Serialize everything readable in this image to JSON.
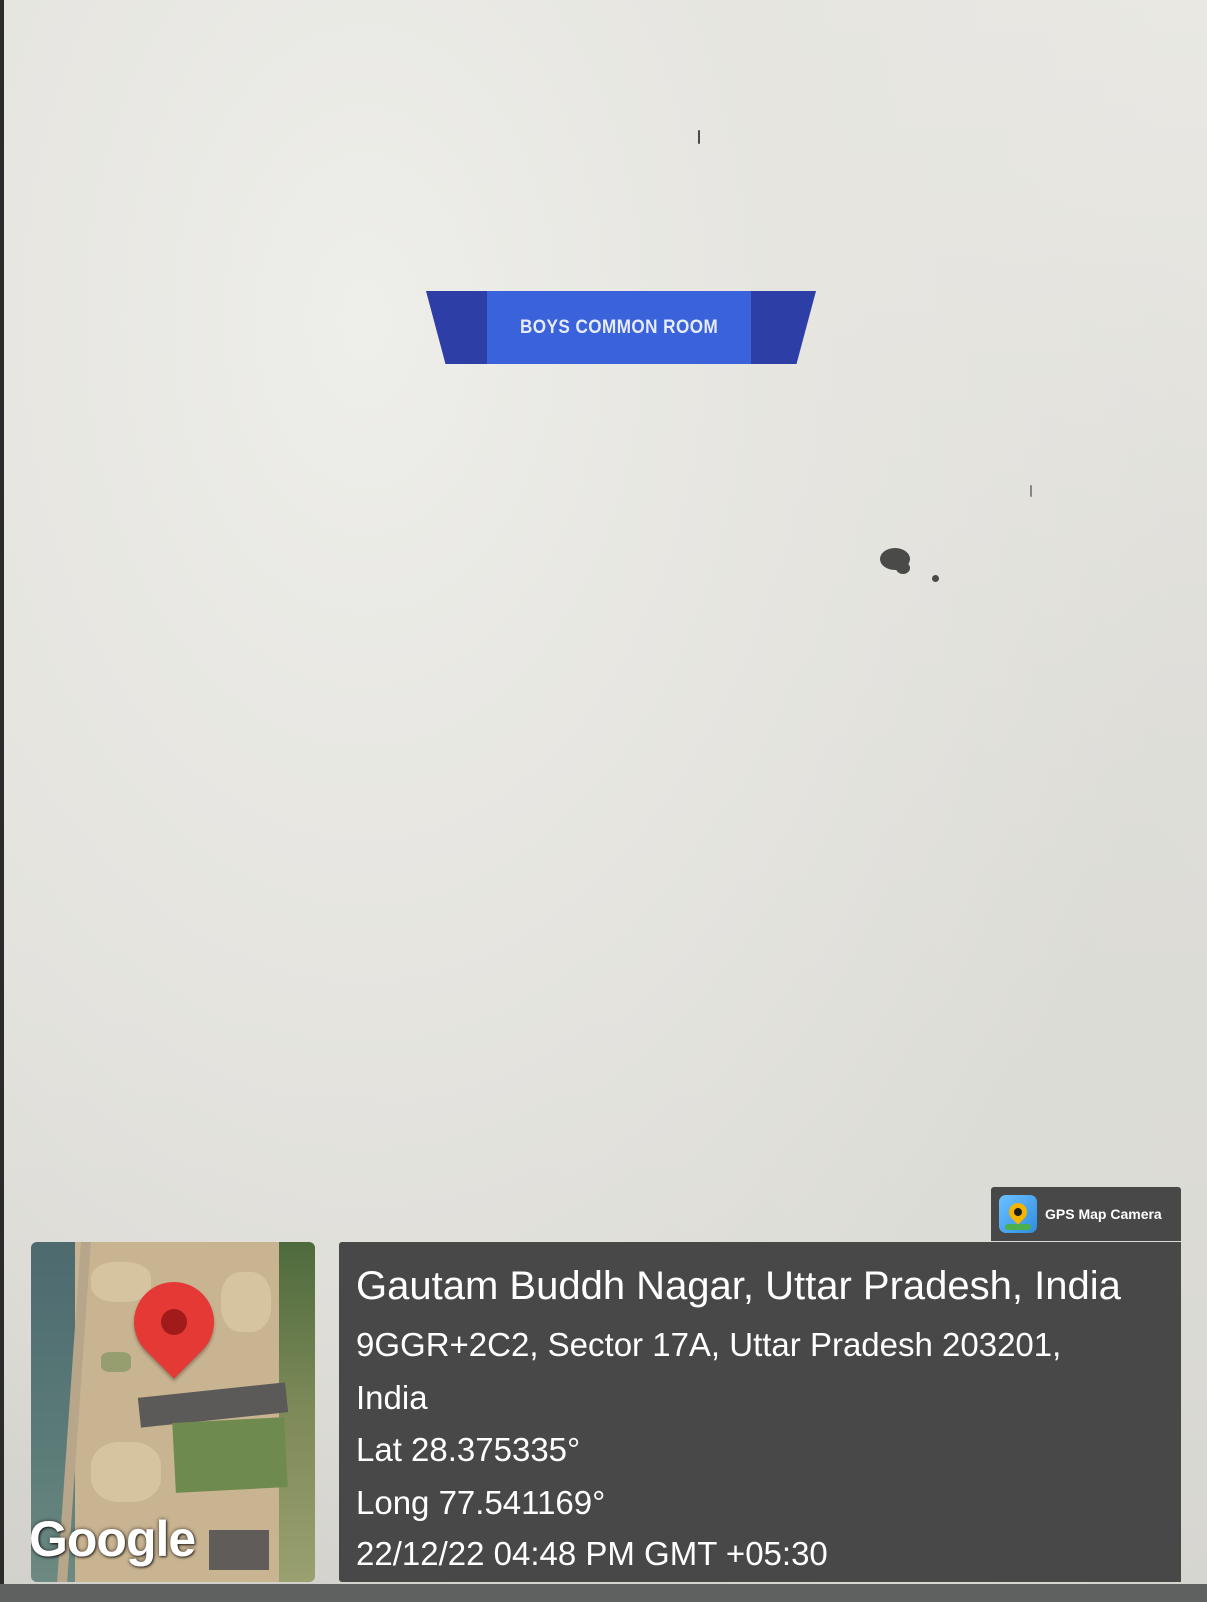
{
  "sign": {
    "text": "BOYS COMMON ROOM"
  },
  "stamp": {
    "brand": "GPS Map Camera",
    "map_logo": "Google",
    "location_title": "Gautam Buddh Nagar, Uttar Pradesh, India",
    "address_line1": "9GGR+2C2, Sector 17A, Uttar Pradesh 203201,",
    "address_line2": "India",
    "latitude": "Lat 28.375335°",
    "longitude": "Long 77.541169°",
    "datetime": "22/12/22 04:48 PM GMT +05:30"
  },
  "colors": {
    "wall": "#e6e5e0",
    "sign_dark": "#2d3fa6",
    "sign_light": "#3a63db",
    "overlay": "#484848",
    "marker": "#e53935"
  }
}
